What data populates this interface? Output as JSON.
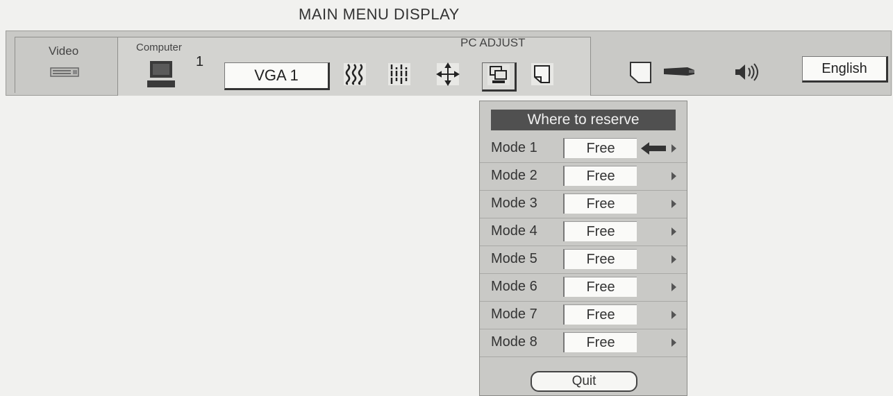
{
  "title": "MAIN MENU DISPLAY",
  "tabs": {
    "video_label": "Video",
    "computer_label": "Computer",
    "computer_number": "1"
  },
  "pc_adjust": {
    "label": "PC ADJUST",
    "source": "VGA 1",
    "tools": [
      "auto-pc-adjust-icon",
      "fine-sync-icon",
      "position-icon",
      "pc-system-mode-icon",
      "mode-reserve-icon"
    ]
  },
  "right_controls": {
    "icons": [
      "screen-icon",
      "projector-icon",
      "speaker-icon"
    ],
    "language": "English"
  },
  "panel": {
    "heading": "Where to reserve",
    "modes": [
      {
        "label": "Mode 1",
        "value": "Free",
        "selected": true
      },
      {
        "label": "Mode 2",
        "value": "Free",
        "selected": false
      },
      {
        "label": "Mode 3",
        "value": "Free",
        "selected": false
      },
      {
        "label": "Mode 4",
        "value": "Free",
        "selected": false
      },
      {
        "label": "Mode 5",
        "value": "Free",
        "selected": false
      },
      {
        "label": "Mode 6",
        "value": "Free",
        "selected": false
      },
      {
        "label": "Mode 7",
        "value": "Free",
        "selected": false
      },
      {
        "label": "Mode 8",
        "value": "Free",
        "selected": false
      }
    ],
    "quit_label": "Quit"
  }
}
